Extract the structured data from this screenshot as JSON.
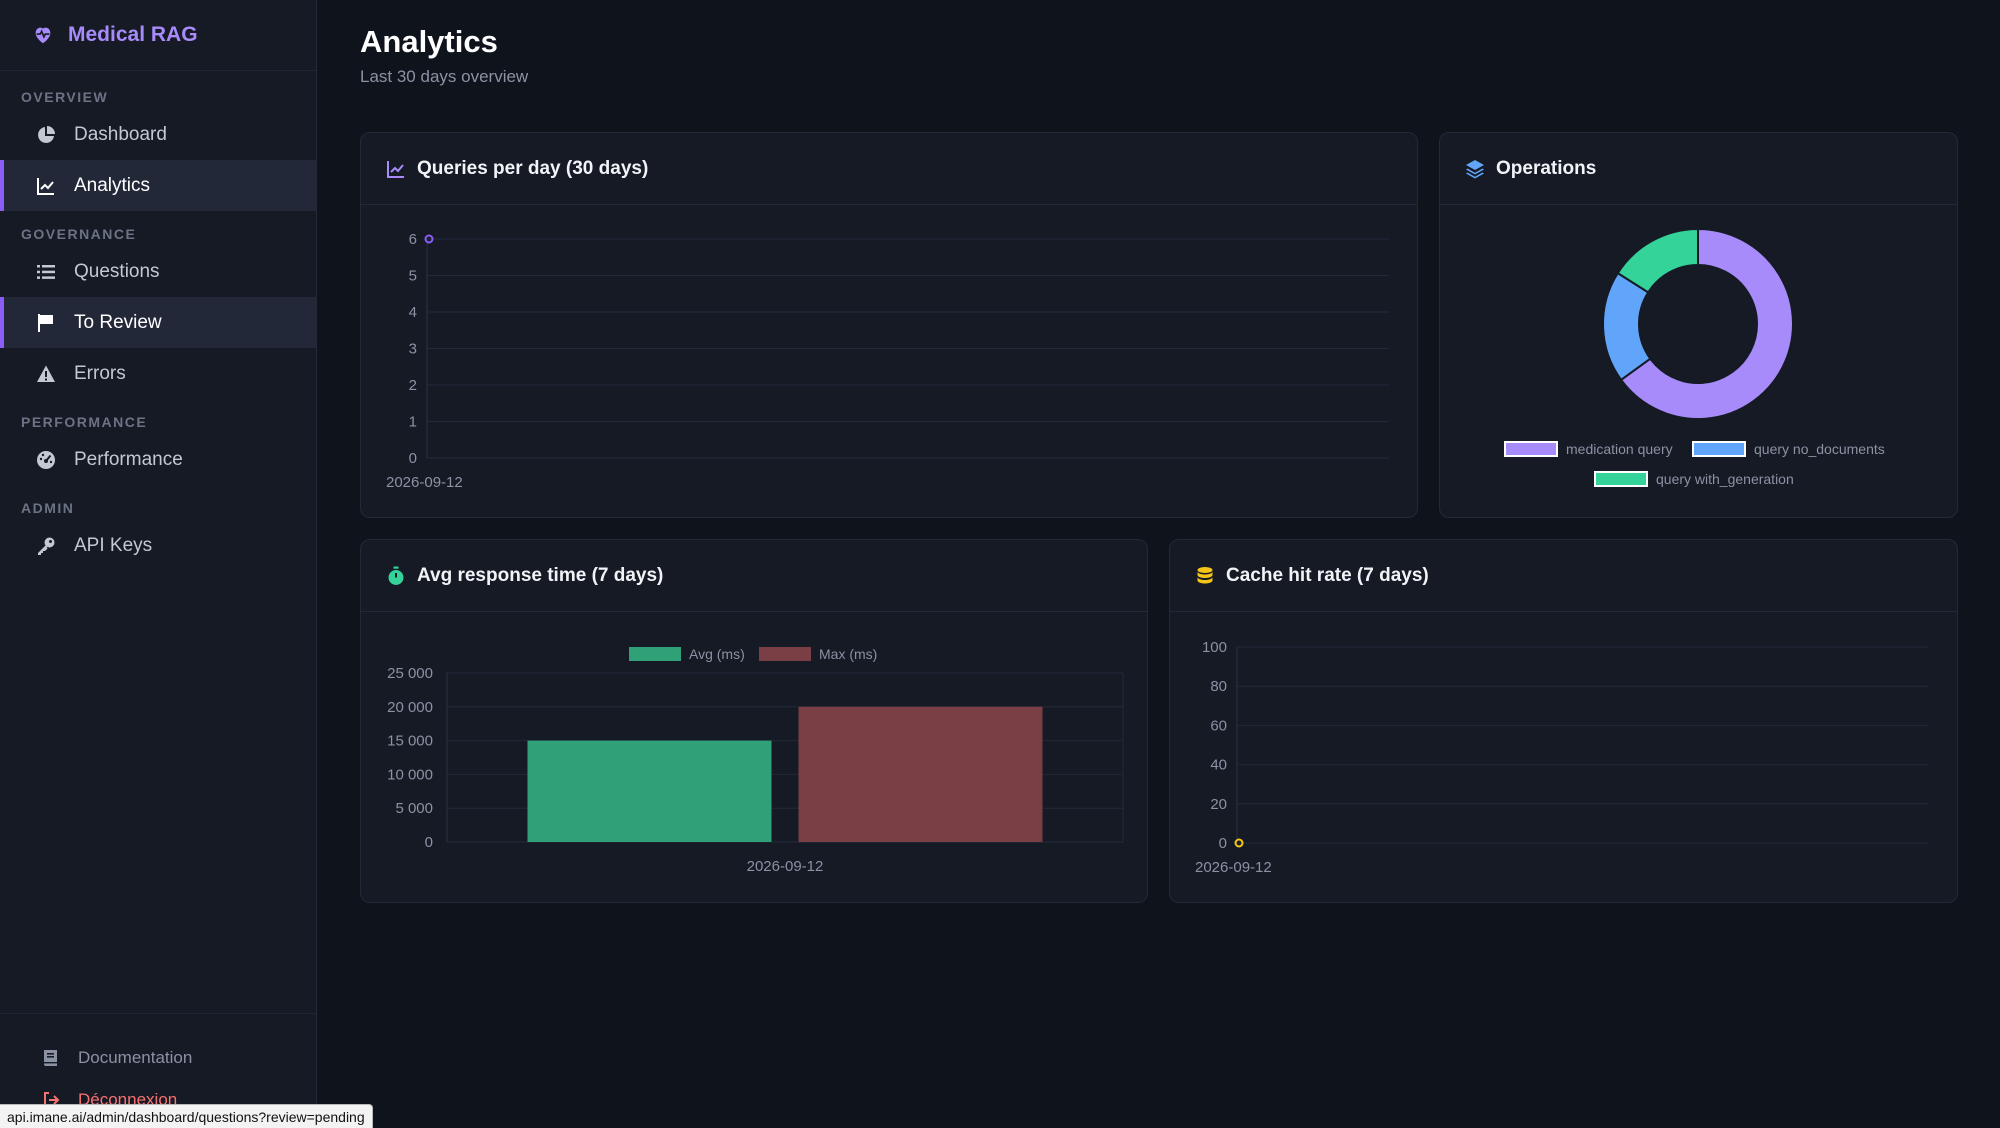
{
  "sidebar": {
    "brand": "Medical RAG",
    "sections": [
      {
        "label": "OVERVIEW",
        "items": [
          {
            "label": "Dashboard",
            "icon": "pie-chart-icon",
            "active": false
          },
          {
            "label": "Analytics",
            "icon": "line-chart-icon",
            "active": true
          }
        ]
      },
      {
        "label": "GOVERNANCE",
        "items": [
          {
            "label": "Questions",
            "icon": "list-icon",
            "active": false
          },
          {
            "label": "To Review",
            "icon": "flag-icon",
            "active": true
          },
          {
            "label": "Errors",
            "icon": "warning-icon",
            "active": false
          }
        ]
      },
      {
        "label": "PERFORMANCE",
        "items": [
          {
            "label": "Performance",
            "icon": "gauge-icon",
            "active": false
          }
        ]
      },
      {
        "label": "ADMIN",
        "items": [
          {
            "label": "API Keys",
            "icon": "key-icon",
            "active": false
          }
        ]
      }
    ],
    "bottom": {
      "documentation": "Documentation",
      "logout": "Déconnexion"
    }
  },
  "page": {
    "title": "Analytics",
    "subtitle": "Last 30 days overview"
  },
  "cards": {
    "queries": {
      "title": "Queries per day (30 days)",
      "icon": "trend-icon"
    },
    "operations": {
      "title": "Operations",
      "icon": "layers-icon"
    },
    "response": {
      "title": "Avg response time (7 days)",
      "icon": "stopwatch-icon"
    },
    "cache": {
      "title": "Cache hit rate (7 days)",
      "icon": "database-icon"
    }
  },
  "status_url": "api.imane.ai/admin/dashboard/questions?review=pending",
  "colors": {
    "accent": "#8b5cf6",
    "avg": "#2fa078",
    "max": "#7a3f44",
    "ops": [
      "#a78bfa",
      "#60a5fa",
      "#34d399"
    ],
    "cache_point": "#f5c518"
  },
  "chart_data": [
    {
      "id": "queries",
      "type": "line",
      "title": "Queries per day (30 days)",
      "x": [
        "2026-09-12"
      ],
      "series": [
        {
          "values": [
            6
          ]
        }
      ],
      "yticks": [
        0,
        1,
        2,
        3,
        4,
        5,
        6
      ],
      "ylim": [
        0,
        6
      ],
      "grid": true
    },
    {
      "id": "operations",
      "type": "pie",
      "title": "Operations",
      "labels": [
        "medication query",
        "query no_documents",
        "query with_generation"
      ],
      "values": [
        65,
        19,
        16
      ],
      "legend": "bottom"
    },
    {
      "id": "response",
      "type": "bar",
      "title": "Avg response time (7 days)",
      "categories": [
        "2026-09-12"
      ],
      "series": [
        {
          "name": "Avg (ms)",
          "values": [
            15000
          ]
        },
        {
          "name": "Max (ms)",
          "values": [
            20000
          ]
        }
      ],
      "yticks": [
        "0",
        "5 000",
        "10 000",
        "15 000",
        "20 000",
        "25 000"
      ],
      "ylim": [
        0,
        25000
      ],
      "legend": "top"
    },
    {
      "id": "cache",
      "type": "line",
      "title": "Cache hit rate (7 days)",
      "x": [
        "2026-09-12"
      ],
      "series": [
        {
          "values": [
            0
          ]
        }
      ],
      "yticks": [
        0,
        20,
        40,
        60,
        80,
        100
      ],
      "ylim": [
        0,
        100
      ],
      "grid": true
    }
  ]
}
